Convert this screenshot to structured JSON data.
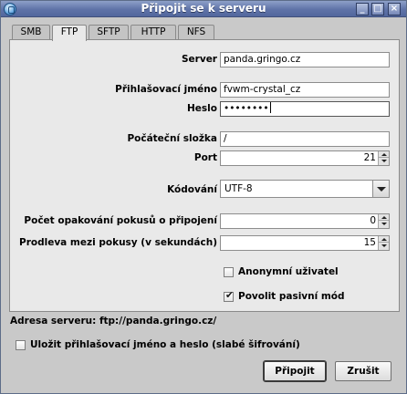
{
  "window": {
    "title": "Připojit se k serveru",
    "accent": "#5f73a8"
  },
  "tabs": [
    {
      "label": "SMB",
      "active": false
    },
    {
      "label": "FTP",
      "active": true
    },
    {
      "label": "SFTP",
      "active": false
    },
    {
      "label": "HTTP",
      "active": false
    },
    {
      "label": "NFS",
      "active": false
    }
  ],
  "form": {
    "server_label": "Server",
    "server_value": "panda.gringo.cz",
    "login_label": "Přihlašovací jméno",
    "login_value": "fvwm-crystal_cz",
    "password_label": "Heslo",
    "password_value": "••••••••",
    "folder_label": "Počáteční složka",
    "folder_value": "/",
    "port_label": "Port",
    "port_value": "21",
    "encoding_label": "Kódování",
    "encoding_value": "UTF-8",
    "retries_label": "Počet opakování pokusů o připojení",
    "retries_value": "0",
    "delay_label": "Prodleva mezi pokusy (v sekundách)",
    "delay_value": "15",
    "anonymous_label": "Anonymní uživatel",
    "anonymous_checked": false,
    "passive_label": "Povolit pasivní mód",
    "passive_checked": true
  },
  "footer": {
    "address_text": "Adresa serveru: ftp://panda.gringo.cz/",
    "save_label": "Uložit přihlašovací jméno a heslo (slabé šifrování)",
    "save_checked": false,
    "connect_label": "Připojit",
    "cancel_label": "Zrušit"
  },
  "icons": {
    "app": "network-icon",
    "min": "minimize-icon",
    "max": "maximize-icon",
    "close": "close-icon",
    "check": "✔"
  }
}
